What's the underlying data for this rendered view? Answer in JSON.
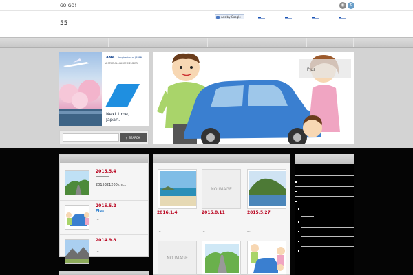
{
  "topbar": {
    "site_tag": "GO!GO!"
  },
  "header": {
    "site_title": "55",
    "ad_label": "Ads by Google"
  },
  "colors": {
    "accent_red": "#b8001c",
    "link_blue": "#1a73c8",
    "ad_blue": "#1f8fe0"
  },
  "ad": {
    "logo": "ANA",
    "tagline": "Inspiration of JAPAN",
    "alliance": "A STAR ALLIANCE MEMBER",
    "copy": [
      "Next time,",
      "Japan."
    ]
  },
  "search": {
    "placeholder": "",
    "button_label": "SEARCH",
    "icon": "search-icon"
  },
  "hero": {
    "overlay_label": "Plus"
  },
  "recent_posts": [
    {
      "date": "2015.5.4",
      "excerpt": "2015321200km...",
      "tag": ""
    },
    {
      "date": "2015.5.2",
      "excerpt": "...",
      "tag": "Plus"
    },
    {
      "date": "2014.9.8",
      "excerpt": "...",
      "tag": ""
    }
  ],
  "cards": [
    {
      "date": "2016.1.4",
      "image": "beach",
      "dots": "..."
    },
    {
      "date": "2015.8.11",
      "image": "no-image",
      "no_image_label": "NO IMAGE",
      "dots": "..."
    },
    {
      "date": "2015.5.27",
      "image": "island",
      "dots": "..."
    },
    {
      "date": "",
      "image": "no-image",
      "no_image_label": "NO IMAGE",
      "dots": ""
    },
    {
      "date": "",
      "image": "road",
      "dots": ""
    },
    {
      "date": "",
      "image": "family-car",
      "dots": ""
    }
  ]
}
